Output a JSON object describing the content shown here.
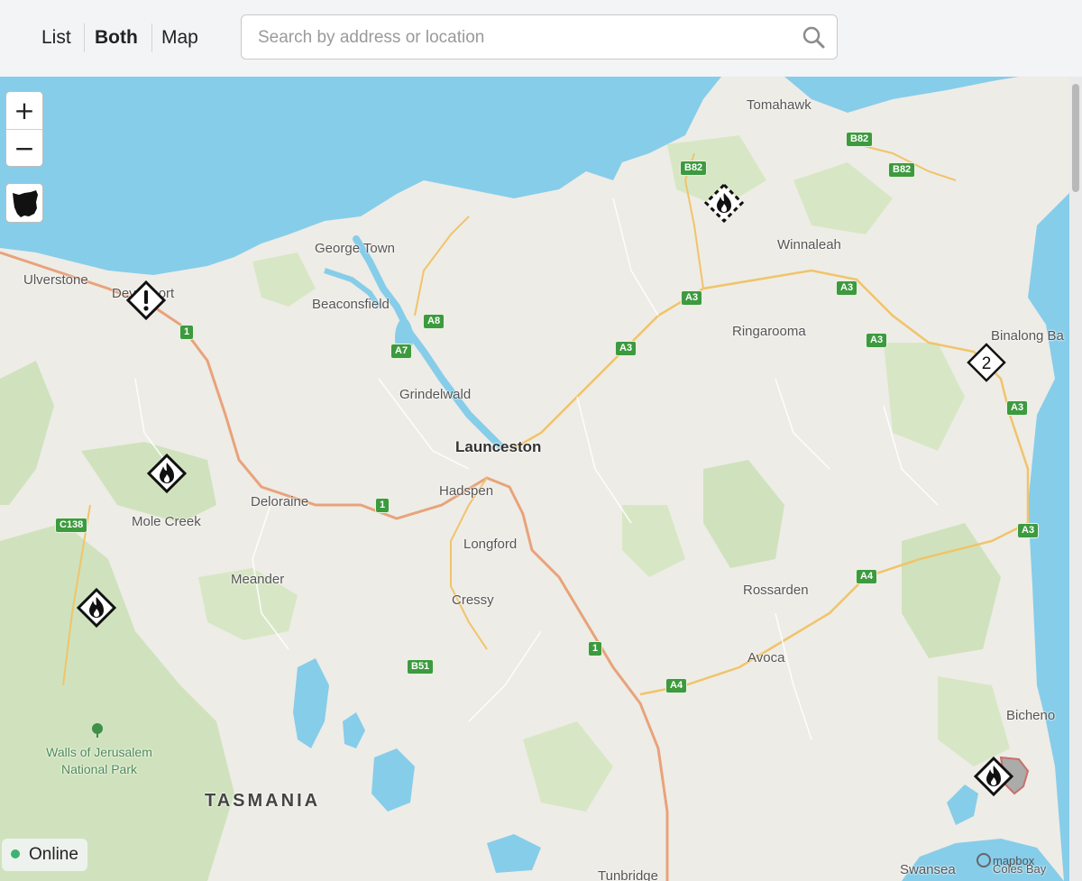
{
  "toolbar": {
    "tabs": [
      {
        "label": "List",
        "active": false
      },
      {
        "label": "Both",
        "active": true
      },
      {
        "label": "Map",
        "active": false
      }
    ],
    "search_placeholder": "Search by address or location",
    "search_value": ""
  },
  "map": {
    "zoom_in_label": "+",
    "zoom_out_label": "−",
    "reset_view_icon": "tasmania-outline-icon",
    "places": {
      "tomahawk": "Tomahawk",
      "ulverstone": "Ulverstone",
      "devonport": "Devonport",
      "george_town": "George Town",
      "beaconsfield": "Beaconsfield",
      "winnaleah": "Winnaleah",
      "ringarooma": "Ringarooma",
      "binalong_bay": "Binalong Ba",
      "grindelwald": "Grindelwald",
      "launceston": "Launceston",
      "hadspen": "Hadspen",
      "deloraine": "Deloraine",
      "mole_creek": "Mole Creek",
      "longford": "Longford",
      "meander": "Meander",
      "rossarden": "Rossarden",
      "cressy": "Cressy",
      "avoca": "Avoca",
      "bicheno": "Bicheno",
      "walls_park_line1": "Walls of Jerusalem",
      "walls_park_line2": "National Park",
      "tasmania": "TASMANIA",
      "swansea": "Swansea",
      "tunbridge": "Tunbridge",
      "coles_bay": "Coles Bay"
    },
    "road_shields": {
      "b82_a": "B82",
      "b82_b": "B82",
      "b82_c": "B82",
      "a3_a": "A3",
      "a3_b": "A3",
      "a3_c": "A3",
      "a3_d": "A3",
      "a3_e": "A3",
      "a3_f": "A3",
      "a8": "A8",
      "a7": "A7",
      "n1_a": "1",
      "n1_b": "1",
      "n1_c": "1",
      "c138": "C138",
      "a4_a": "A4",
      "a4_b": "A4",
      "b51": "B51"
    },
    "markers": [
      {
        "type": "advice",
        "icon": "exclamation-diamond-icon"
      },
      {
        "type": "fire-unconfirmed",
        "icon": "flame-dashed-diamond-icon"
      },
      {
        "type": "cluster",
        "icon": "cluster-diamond-icon",
        "count": "2"
      },
      {
        "type": "fire",
        "icon": "flame-diamond-icon"
      },
      {
        "type": "fire",
        "icon": "flame-diamond-icon"
      },
      {
        "type": "fire",
        "icon": "flame-diamond-icon"
      }
    ],
    "attribution": "mapbox",
    "colors": {
      "water": "#86cdea",
      "land": "#eeece6",
      "forest": "#cfe2bd",
      "road_major": "#f0c46a",
      "highway": "#e8a37b",
      "shield": "#3d9a3f"
    }
  },
  "status": {
    "label": "Online",
    "color": "#3cb371"
  }
}
